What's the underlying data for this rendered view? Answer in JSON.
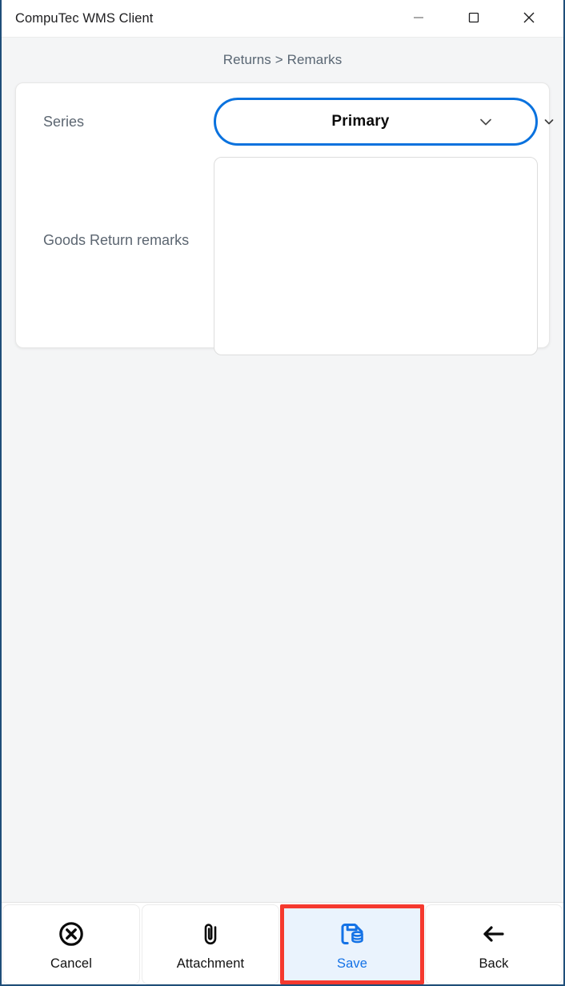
{
  "window": {
    "title": "CompuTec WMS Client",
    "controls": [
      {
        "name": "minimize",
        "glyph": "minimize-icon"
      },
      {
        "name": "maximize",
        "glyph": "maximize-icon"
      },
      {
        "name": "close",
        "glyph": "close-icon"
      }
    ]
  },
  "breadcrumb": {
    "text": "Returns > Remarks",
    "parent": "Returns",
    "separator": ">",
    "current": "Remarks"
  },
  "form": {
    "series": {
      "label": "Series",
      "value": "Primary",
      "options": [
        "Primary"
      ],
      "focused": true,
      "chevron_icon": "chevron-down-icon",
      "chevron_small_icon": "chevron-down-small-icon"
    },
    "remarks": {
      "label": "Goods Return remarks",
      "value": "",
      "placeholder": ""
    }
  },
  "toolbar": {
    "buttons": [
      {
        "label": "Cancel",
        "icon": "circle-x-icon",
        "active": false
      },
      {
        "label": "Attachment",
        "icon": "paperclip-icon",
        "active": false
      },
      {
        "label": "Save",
        "icon": "floppy-disk-database-icon",
        "active": true
      },
      {
        "label": "Back",
        "icon": "arrow-left-icon",
        "active": false
      }
    ]
  },
  "colors": {
    "accent_blue": "#0a72de",
    "save_blue": "#1472e6",
    "highlight_red": "#f5392e",
    "window_border": "#1f4e79",
    "page_background": "#f4f5f6",
    "label_gray": "#5c6671",
    "breadcrumb_gray": "#596673"
  }
}
